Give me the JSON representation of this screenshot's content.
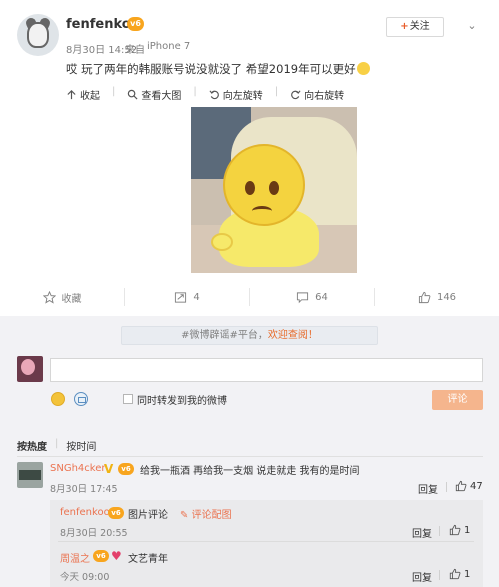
{
  "post": {
    "username": "fenfenkoo",
    "vip_badge": "v6",
    "time": "8月30日 14:52",
    "from_label": "来自",
    "device": "iPhone 7",
    "follow_label": "关注",
    "text": "哎 玩了两年的韩服账号说没就没了 希望2019年可以更好",
    "image_tools": [
      "收起",
      "查看大图",
      "向左旋转",
      "向右旋转"
    ]
  },
  "actions": {
    "favorite_label": "收藏",
    "repost_count": "4",
    "comment_count": "64",
    "like_count": "146"
  },
  "comment_box": {
    "topic_banner_topic": "#微博辟谣#平台，",
    "topic_banner_text": "欢迎查阅！",
    "repost_checkbox_label": "同时转发到我的微博",
    "submit_label": "评论"
  },
  "sort": {
    "hot_label": "按热度",
    "time_label": "按时间"
  },
  "comments": [
    {
      "user": "SNGh4cker",
      "text": "给我一瓶酒 再给我一支烟 说走就走 我有的是时间",
      "time": "8月30日 17:45",
      "reply_label": "回复",
      "likes": "47",
      "replies": [
        {
          "user": "fenfenkoo",
          "text": "图片评论",
          "link": "评论配图",
          "time": "8月30日 20:55",
          "reply_label": "回复",
          "likes": "1"
        },
        {
          "user": "周温之",
          "text": "文艺青年",
          "time": "今天 09:00",
          "reply_label": "回复",
          "likes": "1"
        }
      ]
    }
  ],
  "colors": {
    "accent_orange": "#eb7350",
    "vip_gold": "#f8a51e",
    "submit_disabled": "#f5b58d"
  }
}
